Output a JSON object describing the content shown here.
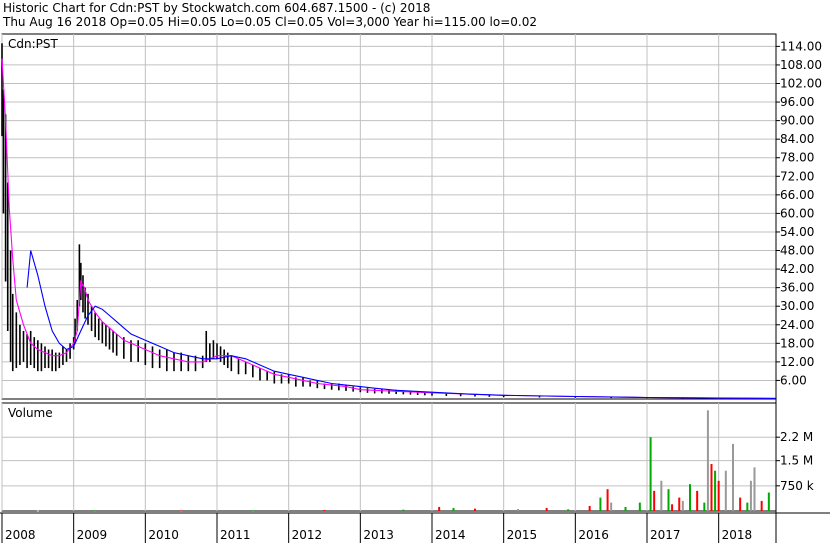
{
  "header": {
    "line1": "Historic Chart for Cdn:PST by Stockwatch.com 604.687.1500 - (c) 2018",
    "line2": "Thu Aug 16 2018  Op=0.05  Hi=0.05  Lo=0.05  Cl=0.05  Vol=3,000  Year hi=115.00  lo=0.02"
  },
  "colors": {
    "grid": "#c0c0c0",
    "price_bar": "#000000",
    "ma_short": "#ff00ff",
    "ma_long": "#0000ff",
    "vol_up": "#00aa00",
    "vol_down": "#ff0000",
    "vol_flat": "#999999"
  },
  "chart_data": [
    {
      "type": "line",
      "title": "Cdn:PST",
      "ylim": [
        0,
        118
      ],
      "yticks": [
        6,
        12,
        18,
        24,
        30,
        36,
        42,
        48,
        54,
        60,
        66,
        72,
        78,
        84,
        90,
        96,
        102,
        108,
        114
      ],
      "ytick_labels": [
        "6.00",
        "12.00",
        "18.00",
        "24.00",
        "30.00",
        "36.00",
        "42.00",
        "48.00",
        "54.00",
        "60.00",
        "66.00",
        "72.00",
        "78.00",
        "84.00",
        "90.00",
        "96.00",
        "102.00",
        "108.00",
        "114.00"
      ],
      "xlim": [
        2008.0,
        2018.8
      ],
      "xticks": [
        2008,
        2009,
        2010,
        2011,
        2012,
        2013,
        2014,
        2015,
        2016,
        2017,
        2018
      ],
      "xtick_labels": [
        "2008",
        "2009",
        "2010",
        "2011",
        "2012",
        "2013",
        "2014",
        "2015",
        "2016",
        "2017",
        "2018"
      ],
      "series": [
        {
          "style": "bars",
          "color": "#000000",
          "x": [
            2008.0,
            2008.02,
            2008.05,
            2008.08,
            2008.12,
            2008.15,
            2008.2,
            2008.25,
            2008.3,
            2008.35,
            2008.4,
            2008.45,
            2008.5,
            2008.55,
            2008.6,
            2008.65,
            2008.7,
            2008.75,
            2008.8,
            2008.85,
            2008.9,
            2008.95,
            2009.0,
            2009.02,
            2009.05,
            2009.08,
            2009.1,
            2009.13,
            2009.16,
            2009.2,
            2009.25,
            2009.3,
            2009.35,
            2009.4,
            2009.45,
            2009.5,
            2009.55,
            2009.6,
            2009.7,
            2009.8,
            2009.9,
            2010.0,
            2010.1,
            2010.2,
            2010.3,
            2010.4,
            2010.5,
            2010.6,
            2010.7,
            2010.8,
            2010.85,
            2010.9,
            2010.95,
            2011.0,
            2011.05,
            2011.1,
            2011.15,
            2011.2,
            2011.3,
            2011.4,
            2011.5,
            2011.6,
            2011.7,
            2011.8,
            2011.9,
            2012.0,
            2012.1,
            2012.2,
            2012.3,
            2012.4,
            2012.5,
            2012.6,
            2012.7,
            2012.8,
            2012.9,
            2013.0,
            2013.1,
            2013.2,
            2013.3,
            2013.4,
            2013.5,
            2013.6,
            2013.7,
            2013.8,
            2013.9,
            2014.0,
            2014.2,
            2014.4,
            2014.6,
            2014.8,
            2015.0,
            2015.5,
            2016.0,
            2016.5,
            2017.0,
            2017.5,
            2018.0,
            2018.5,
            2018.8
          ],
          "high": [
            115,
            100,
            92,
            70,
            48,
            34,
            28,
            24,
            22,
            21,
            22,
            20,
            19,
            18,
            17,
            16,
            16,
            15,
            15,
            17,
            16,
            18,
            20,
            26,
            32,
            50,
            44,
            40,
            36,
            34,
            30,
            28,
            26,
            25,
            24,
            23,
            22,
            21,
            20,
            19,
            19,
            18,
            17,
            16,
            16,
            15,
            15,
            14,
            14,
            14,
            22,
            18,
            19,
            18,
            17,
            16,
            15,
            14,
            13,
            12,
            11,
            10,
            9,
            9,
            8,
            8,
            7,
            7,
            6,
            6,
            5,
            5,
            5,
            4.5,
            4,
            3.8,
            3.5,
            3.3,
            3.2,
            3,
            3,
            2.8,
            2.6,
            2.4,
            2.2,
            2,
            1.8,
            1.6,
            1.5,
            1.3,
            1.2,
            1,
            0.9,
            0.7,
            0.6,
            0.4,
            0.3,
            0.2,
            0.1
          ],
          "low": [
            85,
            60,
            38,
            22,
            12,
            9,
            10,
            11,
            12,
            10,
            11,
            10,
            9,
            9,
            10,
            10,
            9,
            9,
            10,
            11,
            12,
            13,
            16,
            18,
            22,
            30,
            32,
            28,
            26,
            24,
            22,
            20,
            19,
            18,
            17,
            16,
            15,
            14,
            13,
            12,
            12,
            11,
            10,
            10,
            9,
            9,
            9,
            9,
            9,
            10,
            12,
            12,
            13,
            13,
            12,
            11,
            10,
            9,
            8,
            8,
            7,
            6,
            6,
            5,
            5,
            5,
            4,
            4,
            4,
            3.5,
            3.2,
            3,
            2.8,
            2.6,
            2.4,
            2.2,
            2,
            1.8,
            1.8,
            1.7,
            1.6,
            1.5,
            1.4,
            1.3,
            1.2,
            1.1,
            1,
            0.9,
            0.8,
            0.7,
            0.6,
            0.5,
            0.4,
            0.3,
            0.2,
            0.1,
            0.05,
            0.02,
            0.02
          ]
        },
        {
          "style": "line",
          "color": "#ff00ff",
          "x": [
            2008.0,
            2008.05,
            2008.1,
            2008.15,
            2008.2,
            2008.3,
            2008.4,
            2008.5,
            2008.6,
            2008.7,
            2008.8,
            2008.9,
            2009.0,
            2009.05,
            2009.1,
            2009.15,
            2009.2,
            2009.3,
            2009.4,
            2009.5,
            2009.6,
            2009.7,
            2009.8,
            2009.9,
            2010.0,
            2010.2,
            2010.4,
            2010.6,
            2010.8,
            2011.0,
            2011.2,
            2011.4,
            2011.6,
            2011.8,
            2012.0,
            2012.2,
            2012.4,
            2012.6,
            2012.8,
            2013.0,
            2013.5,
            2014.0,
            2014.5,
            2015.0,
            2016.0,
            2017.0,
            2018.0,
            2018.8
          ],
          "y": [
            110,
            90,
            62,
            45,
            32,
            24,
            18,
            16,
            15,
            14,
            14,
            15,
            18,
            22,
            38,
            36,
            32,
            28,
            25,
            23,
            21,
            19,
            18,
            17,
            16,
            14,
            13,
            12,
            12,
            14,
            14,
            12,
            10,
            8,
            7,
            6,
            5,
            4.5,
            4,
            3,
            2.5,
            2,
            1.6,
            1.2,
            0.8,
            0.5,
            0.3,
            0.2
          ]
        },
        {
          "style": "line",
          "color": "#0000ff",
          "x": [
            2008.35,
            2008.4,
            2008.5,
            2008.6,
            2008.7,
            2008.8,
            2008.9,
            2009.0,
            2009.1,
            2009.2,
            2009.3,
            2009.4,
            2009.5,
            2009.6,
            2009.7,
            2009.8,
            2009.9,
            2010.0,
            2010.2,
            2010.4,
            2010.6,
            2010.8,
            2011.0,
            2011.2,
            2011.4,
            2011.6,
            2011.8,
            2012.0,
            2012.2,
            2012.4,
            2012.6,
            2012.8,
            2013.0,
            2013.2,
            2013.5,
            2014.0,
            2014.5,
            2015.0,
            2016.0,
            2017.0,
            2018.0,
            2018.8
          ],
          "y": [
            36,
            48,
            40,
            30,
            22,
            18,
            16,
            17,
            22,
            27,
            30,
            29,
            27,
            25,
            23,
            21,
            20,
            19,
            17,
            15,
            14,
            13,
            13,
            14,
            13,
            11,
            9,
            8,
            7,
            6,
            5,
            4.5,
            4,
            3.5,
            2.8,
            2.2,
            1.6,
            1.2,
            0.8,
            0.5,
            0.3,
            0.2
          ]
        }
      ]
    },
    {
      "type": "bar",
      "title": "Volume",
      "ylim": [
        0,
        3100000
      ],
      "yticks": [
        750000,
        1500000,
        2200000
      ],
      "ytick_labels": [
        "750 k",
        "1.5 M",
        "2.2 M"
      ],
      "xlim": [
        2008.0,
        2018.8
      ],
      "x": [
        2008.5,
        2009.3,
        2010.5,
        2011.5,
        2012.5,
        2013.6,
        2014.1,
        2014.3,
        2014.6,
        2015.2,
        2015.6,
        2015.9,
        2016.2,
        2016.35,
        2016.45,
        2016.5,
        2016.7,
        2016.9,
        2017.05,
        2017.1,
        2017.2,
        2017.3,
        2017.35,
        2017.45,
        2017.5,
        2017.6,
        2017.7,
        2017.8,
        2017.85,
        2017.9,
        2017.95,
        2018.0,
        2018.1,
        2018.2,
        2018.3,
        2018.4,
        2018.45,
        2018.5,
        2018.6,
        2018.7
      ],
      "values": [
        20000,
        25000,
        22000,
        25000,
        30000,
        40000,
        120000,
        90000,
        70000,
        60000,
        90000,
        50000,
        150000,
        400000,
        650000,
        250000,
        120000,
        250000,
        2200000,
        600000,
        900000,
        650000,
        200000,
        400000,
        300000,
        800000,
        600000,
        250000,
        3000000,
        1400000,
        1200000,
        900000,
        1200000,
        2000000,
        400000,
        250000,
        900000,
        1300000,
        300000,
        550000
      ],
      "colors": [
        "#999999",
        "#00aa00",
        "#ff0000",
        "#00aa00",
        "#ff0000",
        "#00aa00",
        "#ff0000",
        "#00aa00",
        "#ff0000",
        "#999999",
        "#ff0000",
        "#00aa00",
        "#ff0000",
        "#00aa00",
        "#ff0000",
        "#999999",
        "#00aa00",
        "#00aa00",
        "#00aa00",
        "#ff0000",
        "#999999",
        "#00aa00",
        "#ff0000",
        "#ff0000",
        "#999999",
        "#00aa00",
        "#ff0000",
        "#00aa00",
        "#999999",
        "#ff0000",
        "#00aa00",
        "#ff0000",
        "#999999",
        "#999999",
        "#ff0000",
        "#00aa00",
        "#999999",
        "#999999",
        "#ff0000",
        "#00aa00"
      ]
    }
  ]
}
